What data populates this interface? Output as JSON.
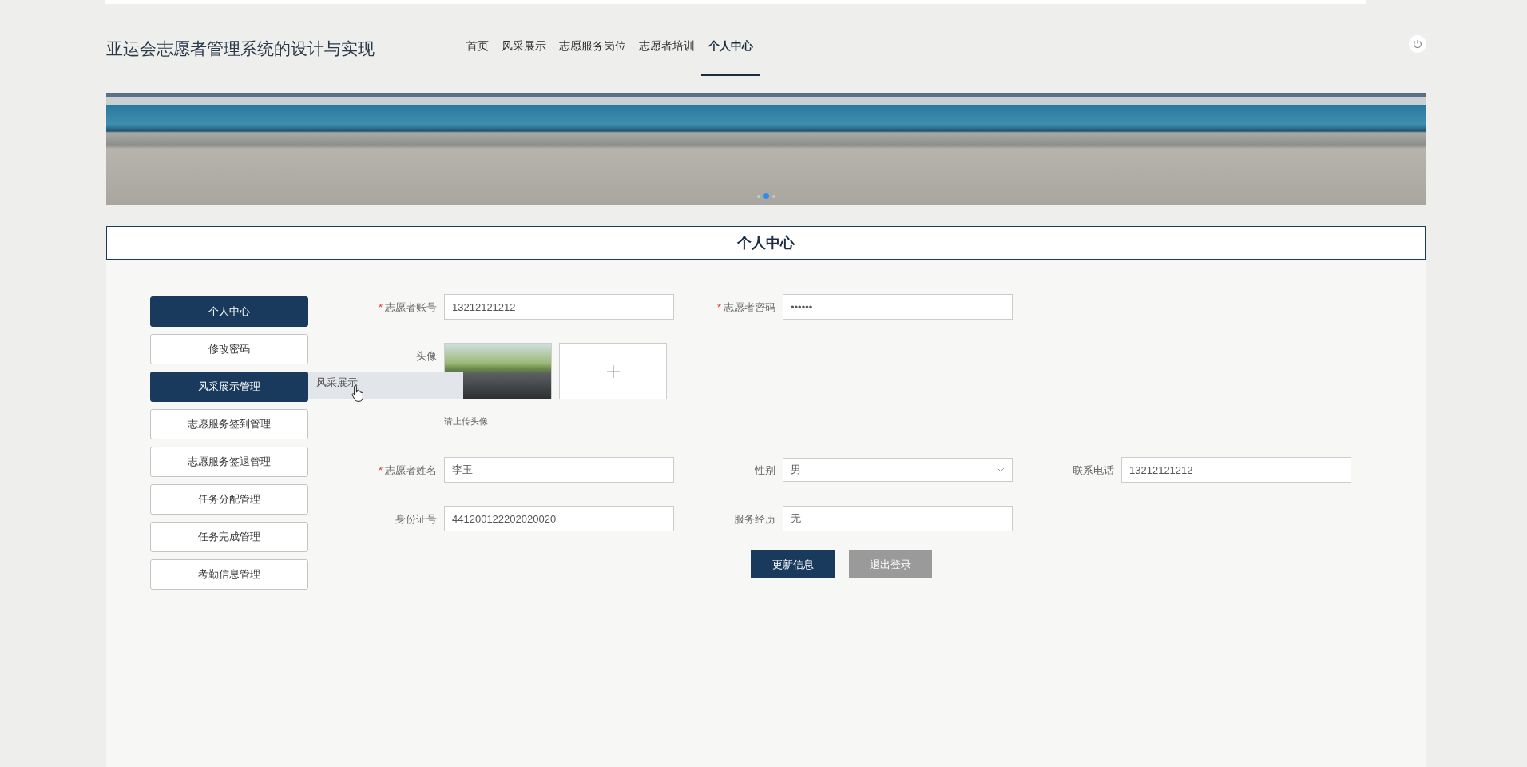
{
  "header": {
    "title": "亚运会志愿者管理系统的设计与实现",
    "nav": [
      {
        "label": "首页",
        "selected": false
      },
      {
        "label": "风采展示",
        "selected": false
      },
      {
        "label": "志愿服务岗位",
        "selected": false
      },
      {
        "label": "志愿者培训",
        "selected": false
      },
      {
        "label": "个人中心",
        "selected": true
      }
    ]
  },
  "banner": {
    "slides": [
      {
        "selected": false
      },
      {
        "selected": true
      },
      {
        "selected": false
      }
    ]
  },
  "panel": {
    "title": "个人中心"
  },
  "sidebar": {
    "items": [
      {
        "label": "个人中心",
        "selected": true
      },
      {
        "label": "修改密码",
        "selected": false
      },
      {
        "label": "风采展示管理",
        "selected": true,
        "submenu": [
          "风采展示"
        ]
      },
      {
        "label": "志愿服务签到管理",
        "selected": false
      },
      {
        "label": "志愿服务签退管理",
        "selected": false
      },
      {
        "label": "任务分配管理",
        "selected": false
      },
      {
        "label": "任务完成管理",
        "selected": false
      },
      {
        "label": "考勤信息管理",
        "selected": false
      }
    ]
  },
  "form": {
    "rows": [
      [
        {
          "kind": "text",
          "required_mark": "*",
          "label": "志愿者账号",
          "value": "13212121212"
        },
        {
          "kind": "password",
          "required_mark": "*",
          "label": "志愿者密码",
          "value": "••••••"
        }
      ],
      [
        {
          "kind": "image",
          "label": "头像",
          "hint": "请上传头像"
        }
      ],
      [
        {
          "kind": "text",
          "required_mark": "*",
          "label": "志愿者姓名",
          "value": "李玉"
        },
        {
          "kind": "select",
          "label": "性别",
          "value": "男"
        },
        {
          "kind": "text",
          "label": "联系电话",
          "value": "13212121212"
        }
      ],
      [
        {
          "kind": "text",
          "label": "身份证号",
          "value": "441200122202020020"
        },
        {
          "kind": "text",
          "label": "服务经历",
          "value": "无"
        }
      ]
    ],
    "buttons": [
      {
        "kind": "primary",
        "label": "更新信息"
      },
      {
        "kind": "secondary",
        "label": "退出登录"
      }
    ]
  }
}
